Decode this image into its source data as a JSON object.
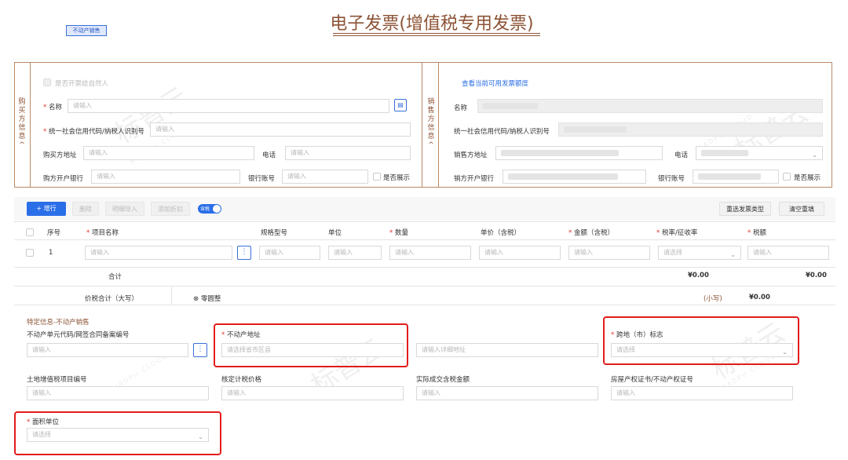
{
  "tag": "不动产销售",
  "title": "电子发票(增值税专用发票)",
  "buyer": {
    "side_label": [
      "购",
      "买",
      "方",
      "信",
      "息"
    ],
    "natural_person_label": "是否开票给自然人",
    "name_label": "名称",
    "name_placeholder": "请输入",
    "tax_id_label": "统一社会信用代码/纳税人识别号",
    "tax_id_placeholder": "请输入",
    "address_label": "购买方地址",
    "address_placeholder": "请输入",
    "phone_label": "电话",
    "phone_placeholder": "请输入",
    "bank_label": "购方开户银行",
    "bank_placeholder": "请输入",
    "account_label": "银行账号",
    "account_placeholder": "请输入",
    "show_label": "是否展示"
  },
  "seller": {
    "side_label": [
      "销",
      "售",
      "方",
      "信",
      "息"
    ],
    "quota_link": "查看当前可用发票额度",
    "name_label": "名称",
    "tax_id_label": "统一社会信用代码/纳税人识别号",
    "address_label": "销售方地址",
    "phone_label": "电话",
    "bank_label": "销方开户银行",
    "account_label": "银行账号",
    "show_label": "是否展示"
  },
  "toolbar": {
    "add_row": "+ 增行",
    "delete": "删除",
    "import_detail": "明细导入",
    "add_discount": "添加折扣",
    "tax_toggle": "含税",
    "reselect": "重选发票类型",
    "clear": "清空重填"
  },
  "table": {
    "headers": [
      "序号",
      "项目名称",
      "规格型号",
      "单位",
      "数量",
      "单价（含税）",
      "金额（含税）",
      "税率/征收率",
      "税额"
    ],
    "required": [
      "",
      "*",
      "",
      "",
      "*",
      "",
      "*",
      "*",
      "*"
    ],
    "row_index": "1",
    "input_placeholder": "请输入",
    "select_placeholder": "请选择",
    "total_label": "合计",
    "total_amount": "¥0.00",
    "total_tax": "¥0.00",
    "grand_label": "价税合计（大写）",
    "grand_words": "⊗ 零圆整",
    "small_label": "(小写)",
    "small_value": "¥0.00"
  },
  "special": {
    "section_title": "特定信息-不动产销售",
    "unit_code_label": "不动产单元代码/网签合同备案编号",
    "unit_code_placeholder": "请输入",
    "address_label": "不动产地址",
    "address_placeholder": "请选择省市区县",
    "detail_placeholder": "请输入详细地址",
    "cross_city_label": "跨地（市）标志",
    "cross_city_placeholder": "请选择",
    "land_vat_label": "土地增值税项目编号",
    "land_vat_placeholder": "请输入",
    "verified_price_label": "核定计税价格",
    "verified_price_placeholder": "请输入",
    "actual_amount_label": "实际成交含税金额",
    "actual_amount_placeholder": "请输入",
    "cert_label": "房屋产权证书/不动产权证号",
    "cert_placeholder": "请输入",
    "area_unit_label": "面积单位",
    "area_unit_placeholder": "请选择"
  },
  "watermark": {
    "text": "标普云",
    "sub": "BIAOPU CLOUD"
  }
}
